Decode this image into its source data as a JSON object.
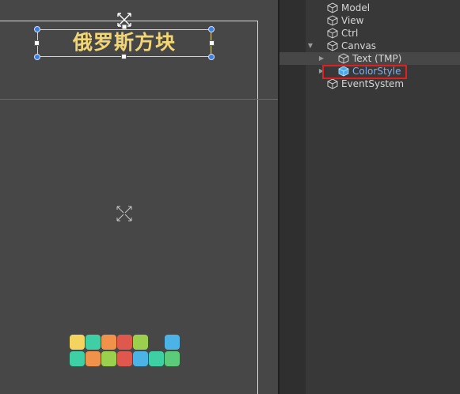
{
  "scene": {
    "title_text": "俄罗斯方块",
    "block_rows": [
      [
        "#f4d35e",
        "#3ecfa4",
        "#f0924a",
        "#e0574e",
        "#9ad04e",
        "",
        "#4cb3e6"
      ],
      [
        "#3ecfa4",
        "#f0924a",
        "#9ad04e",
        "#e0574e",
        "#4cb3e6",
        "#3ecfa4",
        "#5bcb7a"
      ]
    ]
  },
  "hierarchy": {
    "items": [
      {
        "label": "Model",
        "depth": 0,
        "expanded": null,
        "selected": false
      },
      {
        "label": "View",
        "depth": 0,
        "expanded": null,
        "selected": false
      },
      {
        "label": "Ctrl",
        "depth": 0,
        "expanded": null,
        "selected": false
      },
      {
        "label": "Canvas",
        "depth": 0,
        "expanded": true,
        "selected": false
      },
      {
        "label": "Text (TMP)",
        "depth": 1,
        "expanded": false,
        "selected": false
      },
      {
        "label": "ColorStyle",
        "depth": 1,
        "expanded": false,
        "selected": true
      },
      {
        "label": "EventSystem",
        "depth": 0,
        "expanded": null,
        "selected": false
      }
    ]
  },
  "colors": {
    "title_text": "#f2d675",
    "selection_text": "#7fb0f5",
    "highlight_box": "#e02020",
    "anchor_handle": "#3f7fe0"
  },
  "icons": {
    "hierarchy_item": "cube-icon",
    "selected_item": "prefab-cube-icon",
    "expand": "triangle-right-icon",
    "collapse": "triangle-down-icon",
    "scene_pivot": "anchor-flower-icon"
  }
}
